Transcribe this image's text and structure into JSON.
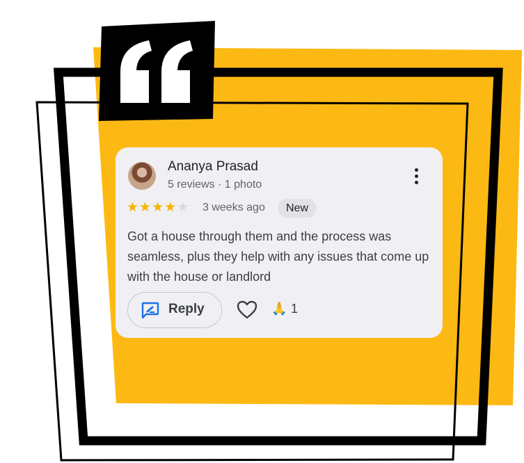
{
  "colors": {
    "background_accent": "#FDB913",
    "frame": "#000000",
    "card_background": "#f0f0f4",
    "star": "#f6b400",
    "reply_icon": "#1a73e8"
  },
  "icons": {
    "quote": "quote-mark-icon",
    "reply": "reply-icon",
    "like": "heart-icon",
    "reaction": "folded-hands-icon",
    "menu": "more-vertical-icon"
  },
  "review": {
    "author": "Ananya Prasad",
    "author_meta": "5 reviews · 1 photo",
    "rating": 4,
    "rating_max": 5,
    "time_ago": "3 weeks ago",
    "badge": "New",
    "text": "Got a house through them and the process was seamless, plus they help with any issues that come up with the house or landlord",
    "reply_label": "Reply",
    "reaction_emoji": "🙏",
    "reaction_count": "1"
  }
}
